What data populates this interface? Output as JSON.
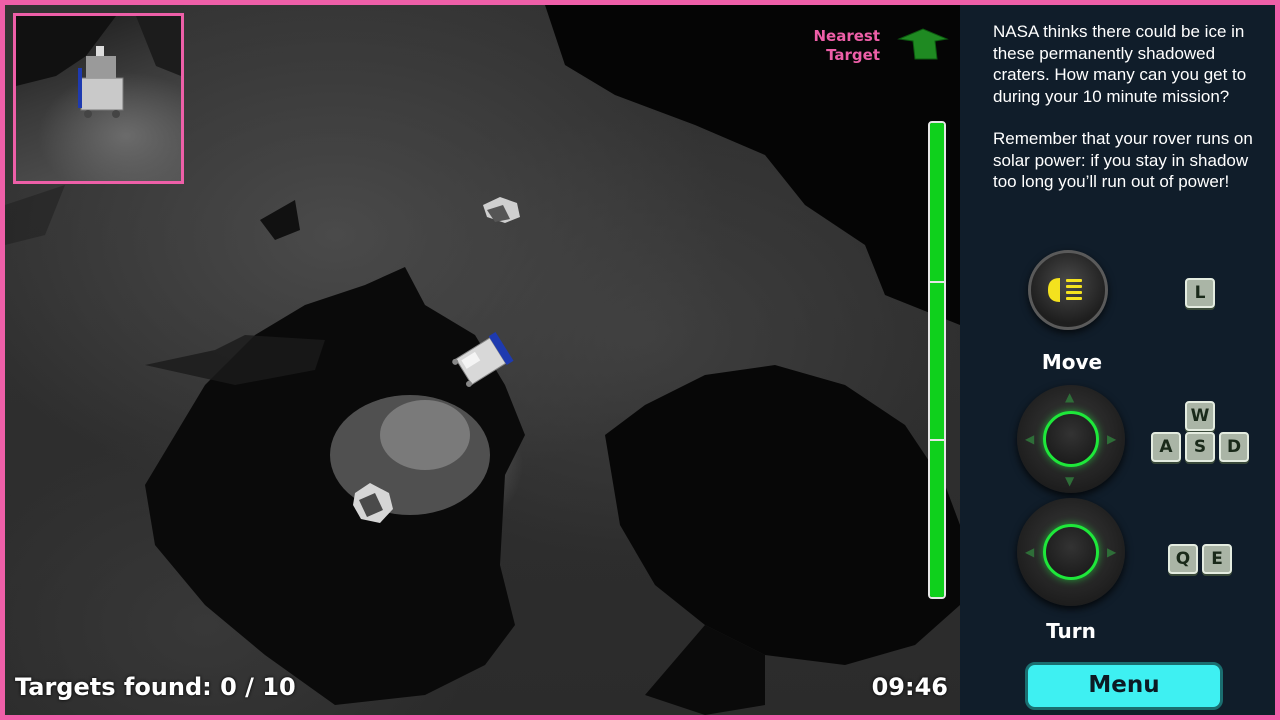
{
  "hud": {
    "nearest_target_label": "Nearest\nTarget",
    "targets_found_label": "Targets found",
    "targets_found_value": "0 / 10",
    "timer": "09:46",
    "power_level": 1.0
  },
  "panel": {
    "info_paragraph_1": "NASA thinks there could be ice in these permanently shadowed craters.  How many can you get to during your 10 minute mission?",
    "info_paragraph_2": "Remember that your rover runs on solar power:  if you stay in shadow too long you’ll run out of power!",
    "light_key": "L",
    "move_label": "Move",
    "move_keys": {
      "up": "W",
      "left": "A",
      "down": "S",
      "right": "D"
    },
    "turn_label": "Turn",
    "turn_keys": {
      "left": "Q",
      "right": "E"
    },
    "menu_label": "Menu"
  },
  "colors": {
    "border": "#ee5fa8",
    "power": "#0fd01c",
    "arrow": "#1f8a22",
    "panel_bg": "#101d2a",
    "menu_bg": "#3ef0f2",
    "joystick_ring": "#1ee83a",
    "headlight": "#f4e21e"
  },
  "icons": {
    "nearest_arrow": "green-arrow-icon",
    "light": "headlight-icon"
  }
}
